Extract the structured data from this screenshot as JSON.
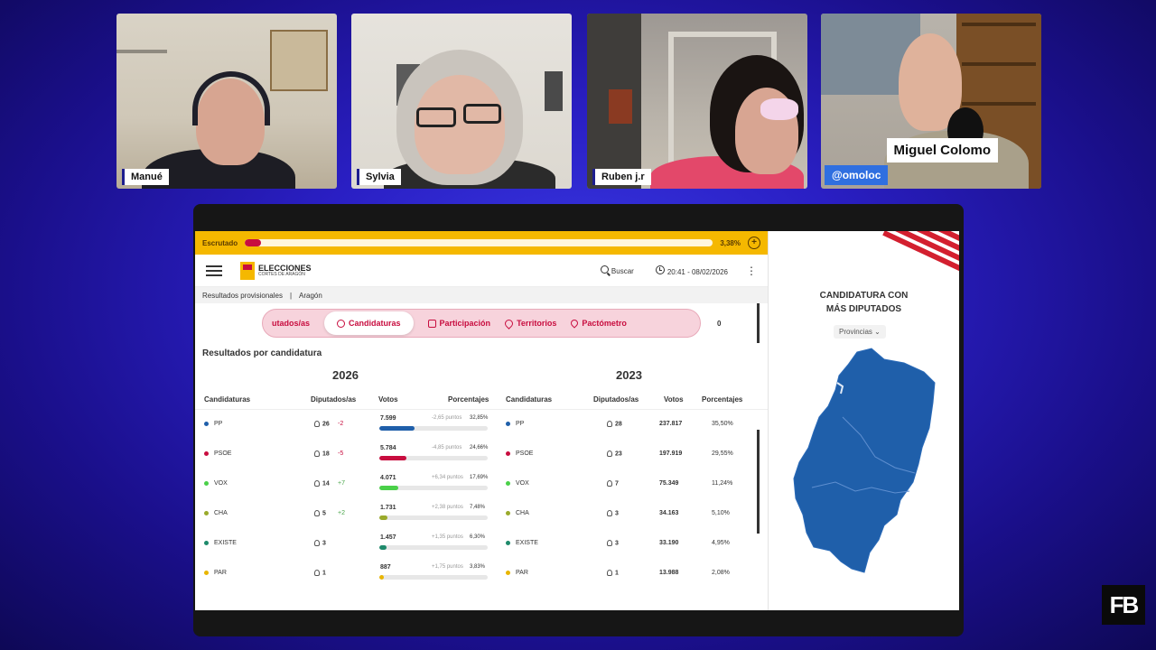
{
  "participants": [
    {
      "name": "Manué"
    },
    {
      "name": "Sylvia"
    },
    {
      "name": "Ruben j.r"
    },
    {
      "name": "Miguel Colomo",
      "handle": "@omoloc"
    }
  ],
  "app": {
    "progress": {
      "label": "Escrutado",
      "value_percent": 3.38,
      "text": "3,38%",
      "plus": "+"
    },
    "logo": {
      "title": "ELECCIONES",
      "subtitle": "CORTES DE ARAGÓN"
    },
    "search_label": "Buscar",
    "datetime": "20:41 - 08/02/2026",
    "kebab": "⋮",
    "breadcrumb": [
      "Resultados provisionales",
      "|",
      "Aragón"
    ],
    "tabs": [
      {
        "label": "utados/as"
      },
      {
        "label": "Candidaturas"
      },
      {
        "label": "Participación"
      },
      {
        "label": "Territorios"
      },
      {
        "label": "Pactómetro"
      }
    ],
    "tabs_side_value": "0",
    "section_title": "Resultados por candidatura",
    "year_current": "2026",
    "year_previous": "2023",
    "headers": {
      "candidaturas": "Candidaturas",
      "diputados": "Diputados/as",
      "votos": "Votos",
      "porcentajes": "Porcentajes"
    },
    "rows": [
      {
        "party": "PP",
        "color": "#1f5faa",
        "seats": "26",
        "seat_delta": "-2",
        "votes": "7.599",
        "delta_pts": "-2,65 puntos",
        "pct": "32,85%",
        "pct_value": 32.85,
        "prev_seats": "28",
        "prev_votes": "237.817",
        "prev_pct": "35,50%"
      },
      {
        "party": "PSOE",
        "color": "#c80d3f",
        "seats": "18",
        "seat_delta": "-5",
        "votes": "5.784",
        "delta_pts": "-4,85 puntos",
        "pct": "24,66%",
        "pct_value": 24.66,
        "prev_seats": "23",
        "prev_votes": "197.919",
        "prev_pct": "29,55%"
      },
      {
        "party": "VOX",
        "color": "#4ad049",
        "seats": "14",
        "seat_delta": "+7",
        "votes": "4.071",
        "delta_pts": "+6,34 puntos",
        "pct": "17,69%",
        "pct_value": 17.69,
        "prev_seats": "7",
        "prev_votes": "75.349",
        "prev_pct": "11,24%"
      },
      {
        "party": "CHA",
        "color": "#9aaa2b",
        "seats": "5",
        "seat_delta": "+2",
        "votes": "1.731",
        "delta_pts": "+2,38 puntos",
        "pct": "7,48%",
        "pct_value": 7.48,
        "prev_seats": "3",
        "prev_votes": "34.163",
        "prev_pct": "5,10%"
      },
      {
        "party": "EXISTE",
        "color": "#1e8a6b",
        "seats": "3",
        "seat_delta": "",
        "votes": "1.457",
        "delta_pts": "+1,35 puntos",
        "pct": "6,30%",
        "pct_value": 6.3,
        "prev_seats": "3",
        "prev_votes": "33.190",
        "prev_pct": "4,95%"
      },
      {
        "party": "PAR",
        "color": "#e8b500",
        "seats": "1",
        "seat_delta": "",
        "votes": "887",
        "delta_pts": "+1,75 puntos",
        "pct": "3,83%",
        "pct_value": 3.83,
        "prev_seats": "1",
        "prev_votes": "13.988",
        "prev_pct": "2,08%"
      }
    ],
    "panel": {
      "title_line1": "CANDIDATURA CON",
      "title_line2": "MÁS DIPUTADOS",
      "select": "Provincias",
      "map_color": "#1f5faa"
    }
  },
  "brand_logo": "FB"
}
